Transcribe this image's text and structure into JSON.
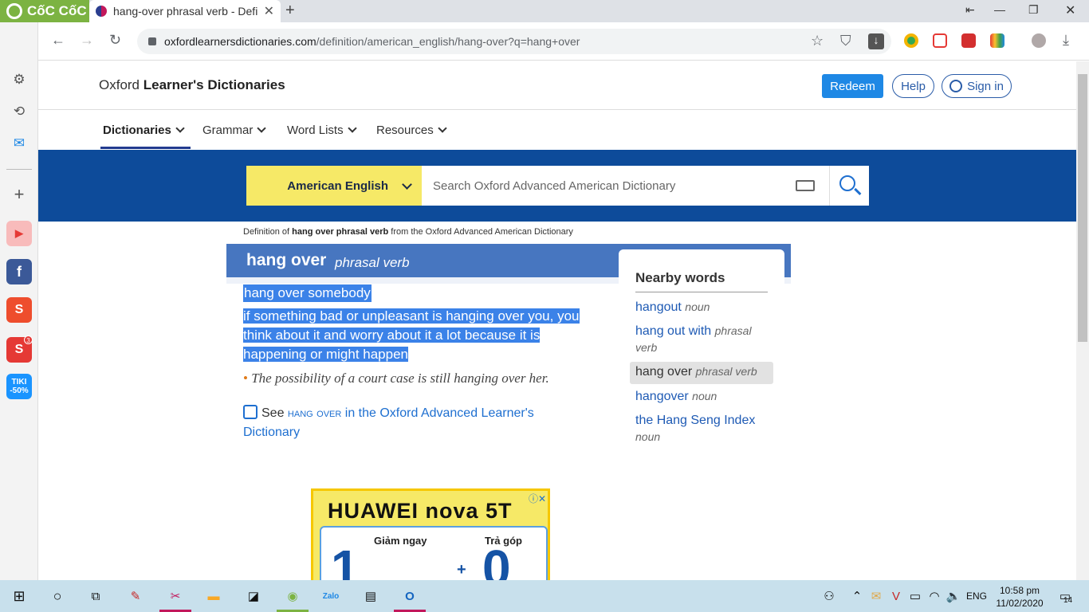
{
  "browser": {
    "brand": "CốC CốC",
    "tab_title": "hang-over phrasal verb - Defi",
    "url_host": "oxfordlearnersdictionaries.com",
    "url_path": "/definition/american_english/hang-over?q=hang+over",
    "window_controls": [
      "⇤",
      "—",
      "❐",
      "✕"
    ]
  },
  "sidebar": {
    "items": [
      {
        "icon": "settings-icon",
        "glyph": "⚙"
      },
      {
        "icon": "history-icon",
        "glyph": "⟲"
      },
      {
        "icon": "messenger-icon",
        "glyph": "✉"
      },
      {
        "icon": "add-icon",
        "glyph": "+"
      },
      {
        "icon": "youtube-icon",
        "glyph": "▶",
        "color": "#e53935"
      },
      {
        "icon": "facebook-icon",
        "glyph": "f",
        "color": "#3b5998"
      },
      {
        "icon": "shopee-icon",
        "glyph": "S",
        "color": "#ee4d2d"
      },
      {
        "icon": "sendo-icon",
        "glyph": "S",
        "color": "#e53935",
        "badge": "3"
      },
      {
        "icon": "tiki-icon",
        "glyph": "TIKI -50%",
        "color": "#1a94ff"
      }
    ]
  },
  "header": {
    "brand_prefix": "Oxford ",
    "brand_bold": "Learner's Dictionaries",
    "redeem": "Redeem",
    "help": "Help",
    "signin": "Sign in"
  },
  "nav": [
    "Dictionaries",
    "Grammar",
    "Word Lists",
    "Resources"
  ],
  "search": {
    "dictionary": "American English",
    "placeholder": "Search Oxford Advanced American Dictionary"
  },
  "entry": {
    "def_of_pre": "Definition of ",
    "def_of_word": "hang over phrasal verb",
    "def_of_post": " from the Oxford Advanced American Dictionary",
    "headword": "hang over",
    "pos": "phrasal verb",
    "idiom": "hang over somebody",
    "definition_lines": [
      "if something bad or unpleasant is hanging over you, you",
      "think about it and worry about it a lot because it is",
      "happening or might happen"
    ],
    "example": "The possibility of a court case is still hanging over her.",
    "see_pre": "See ",
    "see_word": "hang over",
    "see_post": " in the Oxford Advanced Learner's Dictionary"
  },
  "nearby": {
    "title": "Nearby words",
    "items": [
      {
        "word": "hangout",
        "pos": "noun"
      },
      {
        "word": "hang out with",
        "pos": "phrasal verb"
      },
      {
        "word": "hang over",
        "pos": "phrasal verb"
      },
      {
        "word": "hangover",
        "pos": "noun"
      },
      {
        "word": "the Hang Seng Index",
        "pos": "noun"
      }
    ]
  },
  "ad": {
    "brand": "HUAWEI nova 5T",
    "left_label": "Giảm ngay",
    "right_label": "Trả góp",
    "big_left": "1",
    "big_plus": "+",
    "big_right": "0"
  },
  "taskbar": {
    "lang": "ENG",
    "time": "10:58 pm",
    "date": "11/02/2020",
    "notifications": "14"
  },
  "colors": {
    "banner": "#0d4b9a",
    "headword_bar": "#4776c0",
    "dict_selector": "#f6e967",
    "selection": "#3b82e8",
    "link": "#1e5ab4"
  }
}
